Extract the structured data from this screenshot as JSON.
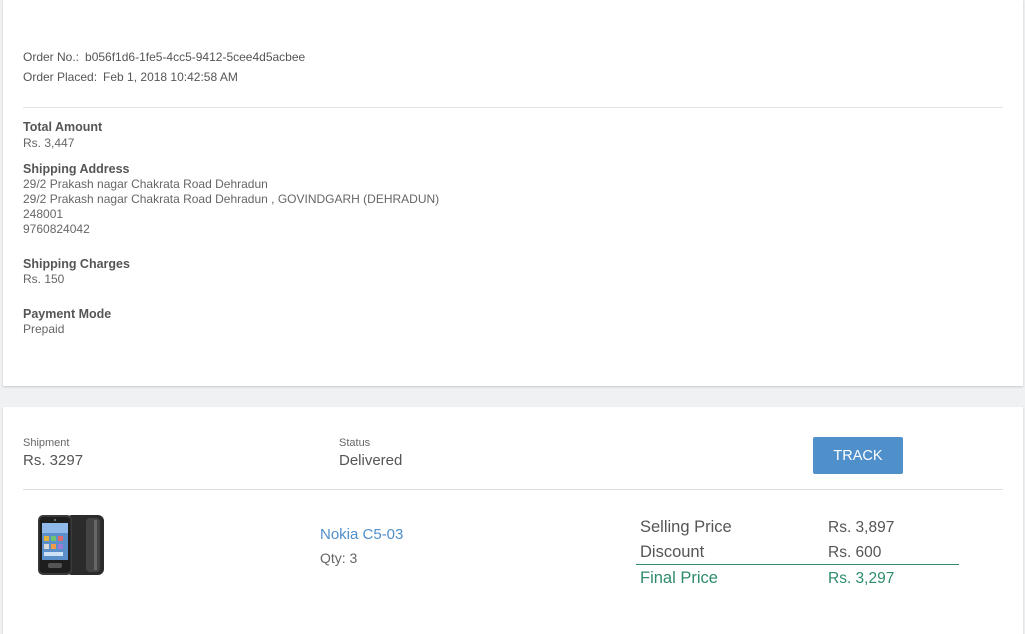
{
  "order": {
    "number_label": "Order No.:",
    "number_value": "b056f1d6-1fe5-4cc5-9412-5cee4d5acbee",
    "placed_label": "Order Placed:",
    "placed_value": "Feb 1, 2018 10:42:58 AM"
  },
  "total": {
    "title": "Total Amount",
    "value": "Rs. 3,447"
  },
  "shipping_address": {
    "title": "Shipping Address",
    "line1": "29/2 Prakash nagar Chakrata Road Dehradun",
    "line2": "29/2 Prakash nagar Chakrata Road Dehradun , GOVINDGARH (DEHRADUN)",
    "pincode": "248001",
    "phone": "9760824042"
  },
  "shipping_charges": {
    "title": "Shipping Charges",
    "value": "Rs. 150"
  },
  "payment_mode": {
    "title": "Payment Mode",
    "value": "Prepaid"
  },
  "shipment": {
    "label": "Shipment",
    "value": "Rs. 3297",
    "status_label": "Status",
    "status_value": "Delivered",
    "track_label": "TRACK"
  },
  "product": {
    "name": "Nokia C5-03",
    "qty": "Qty: 3",
    "image_icon": "phone-image",
    "selling_price_label": "Selling Price",
    "selling_price_value": "Rs. 3,897",
    "discount_label": "Discount",
    "discount_value": "Rs. 600",
    "final_price_label": "Final Price",
    "final_price_value": "Rs. 3,297"
  },
  "colors": {
    "accent": "#4f8fca",
    "final": "#2e8b6b"
  }
}
